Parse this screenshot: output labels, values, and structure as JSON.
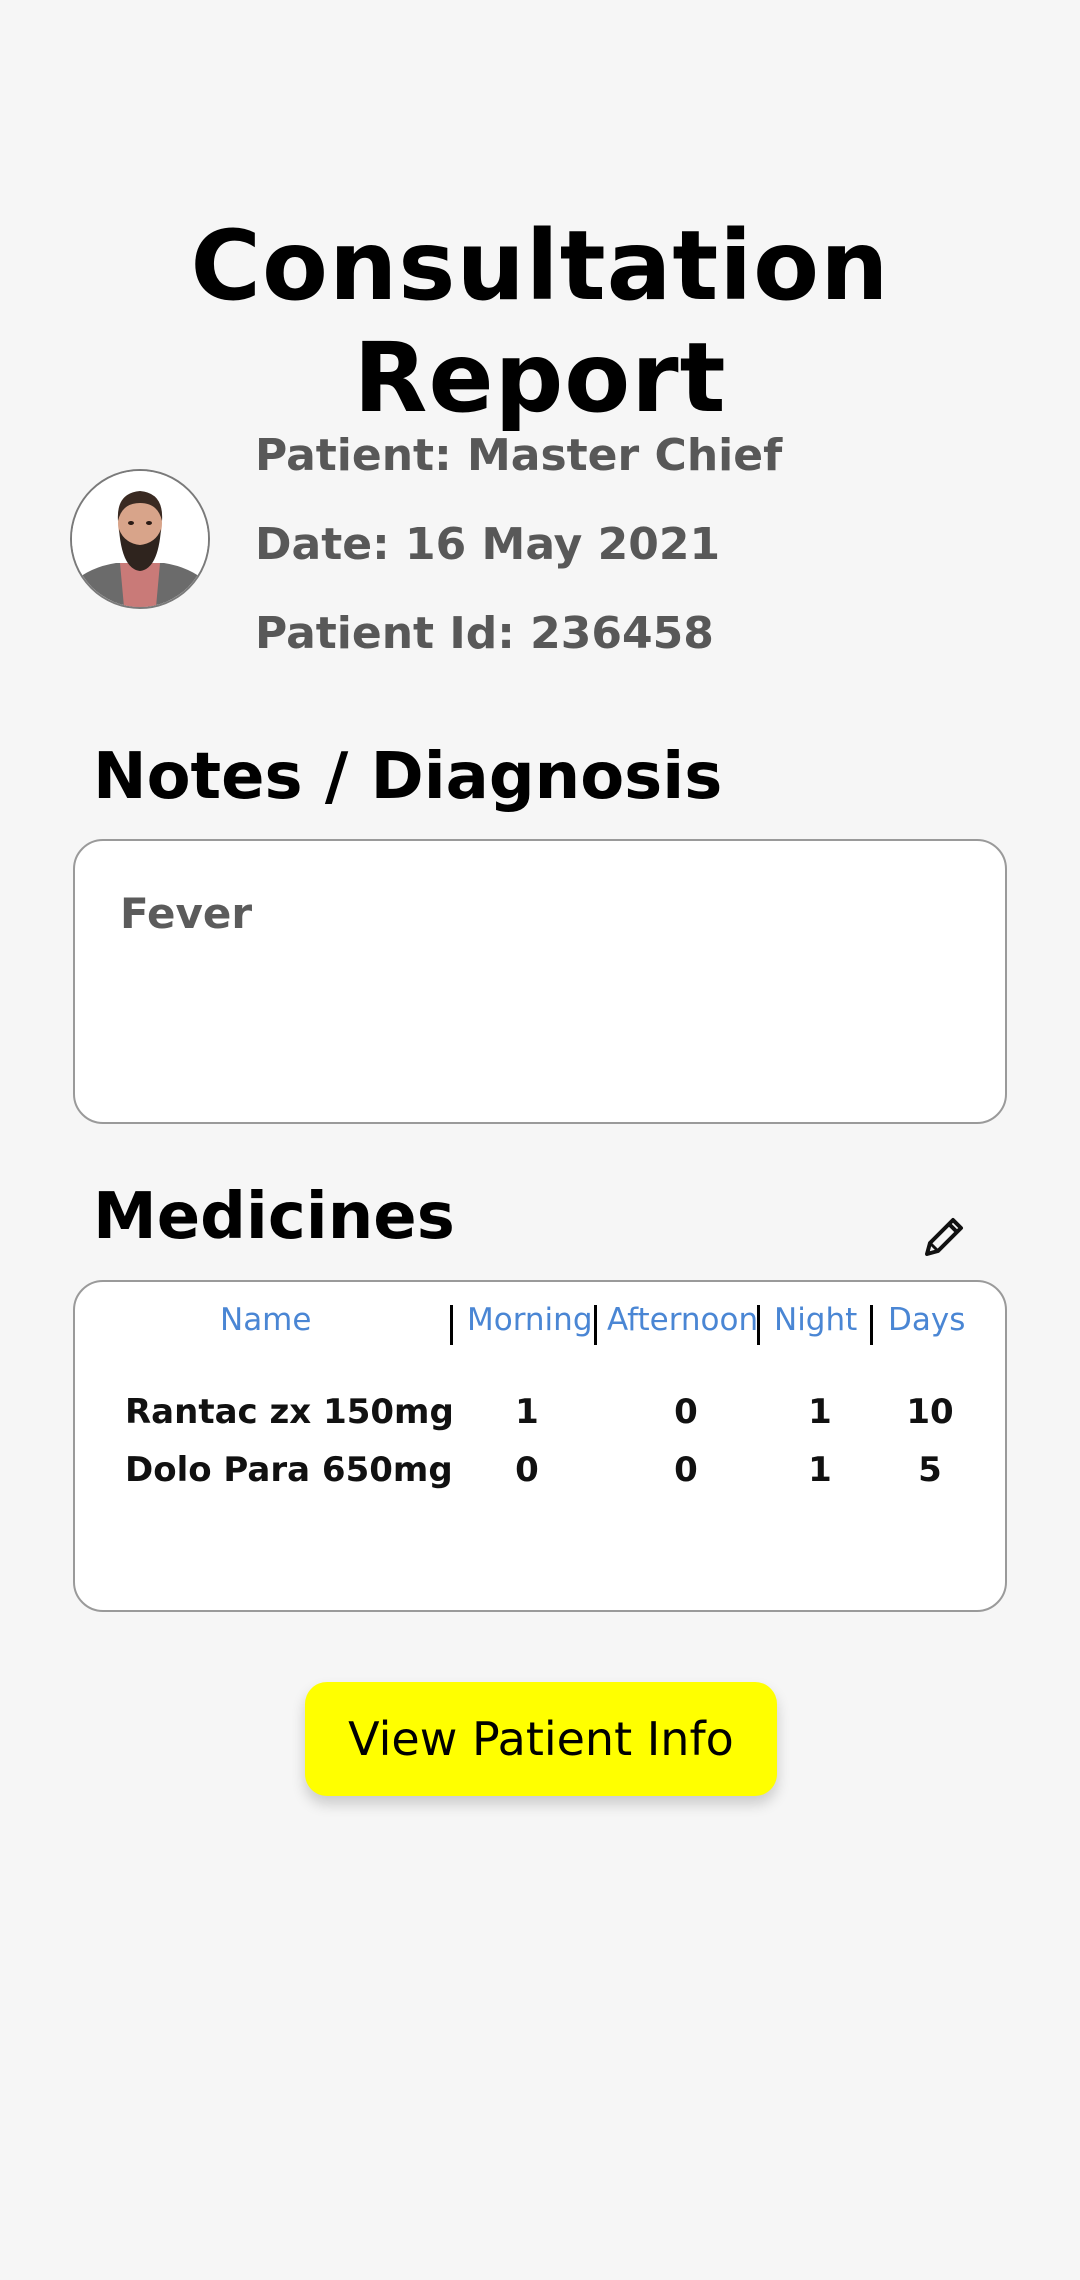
{
  "header": {
    "title": "Consultation Report"
  },
  "patient": {
    "avatar_icon": "patient-avatar",
    "name_line": "Patient: Master Chief",
    "date_line": "Date: 16 May 2021",
    "id_line": "Patient Id: 236458"
  },
  "notes": {
    "section_title": "Notes / Diagnosis",
    "text": "Fever"
  },
  "medicines": {
    "section_title": "Medicines",
    "edit_icon": "pencil-icon",
    "columns": [
      "Name",
      "Morning",
      "Afternoon",
      "Night",
      "Days"
    ],
    "rows": [
      {
        "name": "Rantac zx 150mg",
        "morning": "1",
        "afternoon": "0",
        "night": "1",
        "days": "10"
      },
      {
        "name": "Dolo Para 650mg",
        "morning": "0",
        "afternoon": "0",
        "night": "1",
        "days": "5"
      }
    ]
  },
  "actions": {
    "view_patient_info": "View Patient Info"
  },
  "colors": {
    "background": "#f6f6f6",
    "header_accent": "#4a86d4",
    "button": "#ffff00"
  }
}
